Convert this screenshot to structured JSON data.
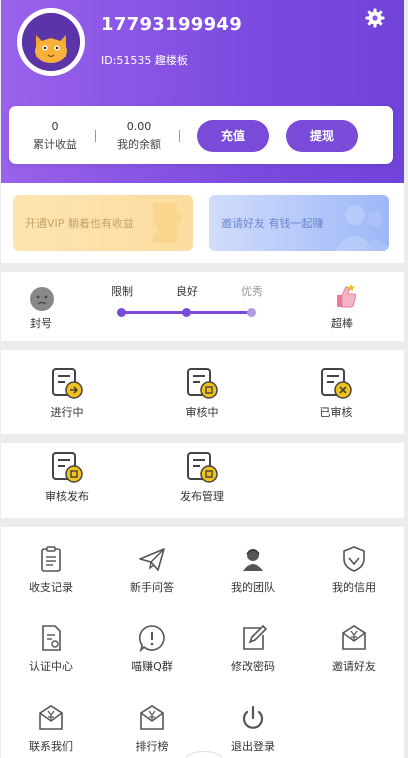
{
  "user": {
    "phone": "17793199949",
    "id_label": "ID:51535 趣楼板",
    "avatar_text": "喵咪"
  },
  "balance": {
    "total_income_value": "0",
    "total_income_label": "累计收益",
    "my_balance_value": "0.00",
    "my_balance_label": "我的余额",
    "recharge_button": "充值",
    "withdraw_button": "提现"
  },
  "banners": {
    "vip": "开通VIP 躺着也有收益",
    "invite": "邀请好友 有钱一起赚"
  },
  "credit": {
    "banned_label": "封号",
    "levels": [
      "限制",
      "良好",
      "优秀"
    ],
    "excellent_label": "超棒"
  },
  "tasks": [
    {
      "label": "进行中",
      "icon": "task-in-progress-icon"
    },
    {
      "label": "审核中",
      "icon": "task-reviewing-icon"
    },
    {
      "label": "已审核",
      "icon": "task-reviewed-icon"
    },
    {
      "label": "审核发布",
      "icon": "review-publish-icon"
    },
    {
      "label": "发布管理",
      "icon": "publish-manage-icon"
    }
  ],
  "menu": [
    {
      "label": "收支记录",
      "icon": "clipboard-icon"
    },
    {
      "label": "新手问答",
      "icon": "paper-plane-icon"
    },
    {
      "label": "我的团队",
      "icon": "team-icon"
    },
    {
      "label": "我的信用",
      "icon": "shield-icon"
    },
    {
      "label": "认证中心",
      "icon": "certificate-icon"
    },
    {
      "label": "喵赚Q群",
      "icon": "alert-bubble-icon"
    },
    {
      "label": "修改密码",
      "icon": "edit-icon"
    },
    {
      "label": "邀请好友",
      "icon": "envelope-yen-icon"
    },
    {
      "label": "联系我们",
      "icon": "envelope-yen-icon"
    },
    {
      "label": "排行榜",
      "icon": "envelope-yen-icon"
    },
    {
      "label": "退出登录",
      "icon": "power-icon"
    }
  ],
  "colors": {
    "primary": "#7a4bd8",
    "header_start": "#9a62ec",
    "header_end": "#7043d9",
    "icon_yellow": "#f2c21b"
  }
}
